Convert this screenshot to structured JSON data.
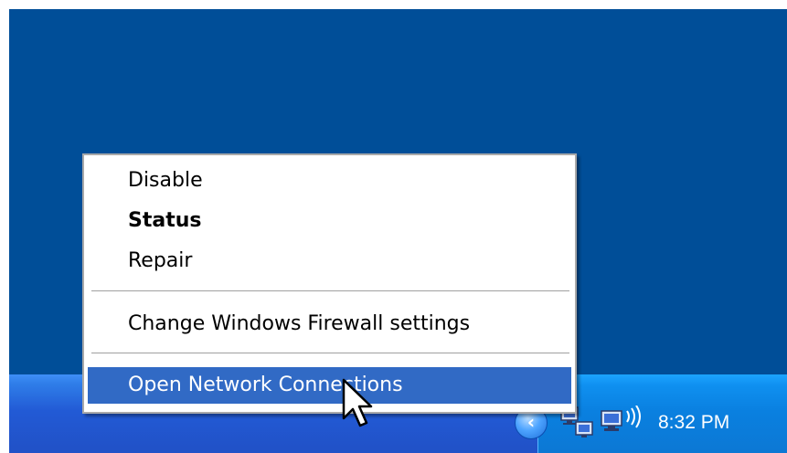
{
  "context_menu": {
    "items": [
      {
        "label": "Disable"
      },
      {
        "label": "Status"
      },
      {
        "label": "Repair"
      },
      {
        "label": "Change Windows Firewall settings"
      },
      {
        "label": "Open Network Connections"
      }
    ]
  },
  "taskbar": {
    "clock": "8:32 PM",
    "tray_icons": [
      "show-hidden-icons-chevron-icon",
      "network-connection-icon",
      "wireless-network-icon"
    ]
  },
  "colors": {
    "desktop": "#004e98",
    "taskbar": "#225ad5",
    "tray": "#0c84e4",
    "menu_highlight": "#316ac5"
  }
}
